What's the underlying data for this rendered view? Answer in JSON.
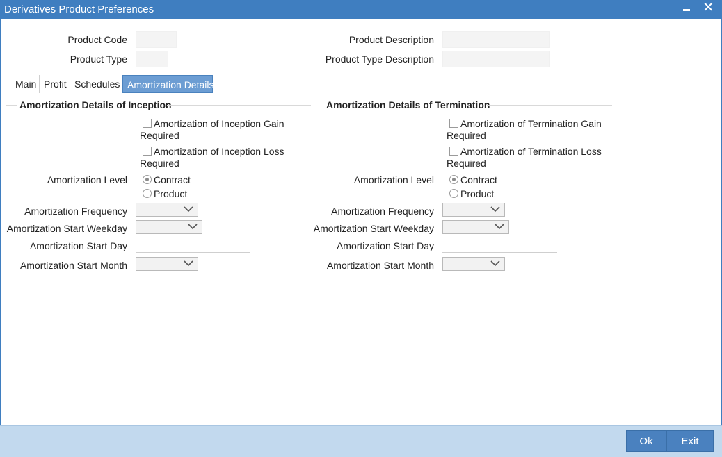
{
  "window": {
    "title": "Derivatives Product Preferences",
    "minimize_icon": "minimize-icon",
    "close_icon": "close-icon",
    "close_glyph": "✕"
  },
  "header": {
    "product_code_label": "Product Code",
    "product_code_value": "",
    "product_type_label": "Product Type",
    "product_type_value": "",
    "product_description_label": "Product Description",
    "product_description_value": "",
    "product_type_description_label": "Product Type Description",
    "product_type_description_value": ""
  },
  "tabs": [
    {
      "label": "Main",
      "active": false
    },
    {
      "label": "Profit",
      "active": false
    },
    {
      "label": "Schedules",
      "active": false
    },
    {
      "label": "Amortization Details",
      "active": true
    }
  ],
  "inception": {
    "title": "Amortization Details of Inception",
    "gain_label_1": "Amortization of Inception Gain",
    "gain_label_2": "Required",
    "gain_checked": false,
    "loss_label_1": "Amortization of Inception Loss",
    "loss_label_2": "Required",
    "loss_checked": false,
    "level_label": "Amortization Level",
    "level_options": [
      "Contract",
      "Product"
    ],
    "level_selected": "Contract",
    "frequency_label": "Amortization Frequency",
    "frequency_value": "",
    "start_weekday_label": "Amortization Start Weekday",
    "start_weekday_value": "",
    "start_day_label": "Amortization Start Day",
    "start_day_value": "",
    "start_month_label": "Amortization Start Month",
    "start_month_value": ""
  },
  "termination": {
    "title": "Amortization Details of Termination",
    "gain_label_1": "Amortization of Termination Gain",
    "gain_label_2": "Required",
    "gain_checked": false,
    "loss_label_1": "Amortization of Termination Loss",
    "loss_label_2": "Required",
    "loss_checked": false,
    "level_label": "Amortization Level",
    "level_options": [
      "Contract",
      "Product"
    ],
    "level_selected": "Contract",
    "frequency_label": "Amortization Frequency",
    "frequency_value": "",
    "start_weekday_label": "Amortization Start Weekday",
    "start_weekday_value": "",
    "start_day_label": "Amortization Start Day",
    "start_day_value": "",
    "start_month_label": "Amortization Start Month",
    "start_month_value": ""
  },
  "footer": {
    "ok_label": "Ok",
    "exit_label": "Exit"
  },
  "colors": {
    "titlebar": "#3f7ec0",
    "active_tab": "#6c9dd3",
    "footer": "#c2d9ee",
    "button": "#4a81bf"
  }
}
